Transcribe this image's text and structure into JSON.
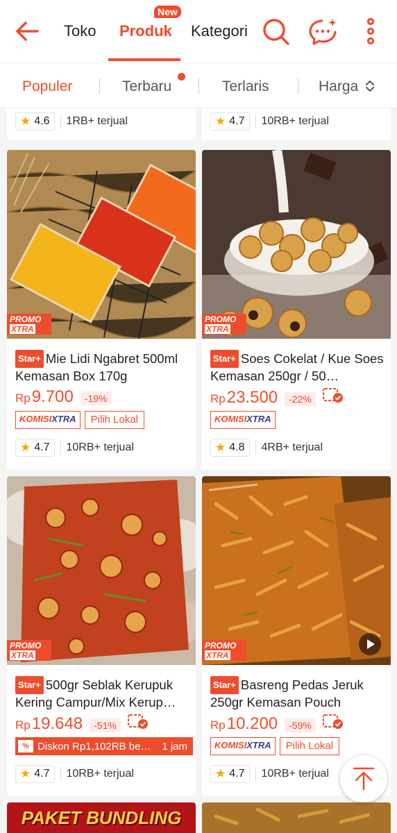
{
  "header": {
    "tabs": [
      {
        "label": "Toko"
      },
      {
        "label": "Produk"
      },
      {
        "label": "Kategori"
      }
    ],
    "new_badge": "New",
    "icons": [
      "back-arrow-icon",
      "search-icon",
      "chat-icon",
      "more-vertical-icon"
    ]
  },
  "sort": {
    "options": [
      {
        "label": "Populer"
      },
      {
        "label": "Terbaru"
      },
      {
        "label": "Terlaris"
      },
      {
        "label": "Harga"
      }
    ]
  },
  "top_partial": [
    {
      "rating": "4.6",
      "sold": "1RB+ terjual"
    },
    {
      "rating": "4.7",
      "sold": "10RB+ terjual"
    }
  ],
  "products": [
    {
      "badge": "Star+",
      "title": "Mie Lidi Ngabret 500ml Kemasan Box 170g",
      "currency": "Rp",
      "price": "9.700",
      "discount": "-19%",
      "promo_label": "PROMO",
      "promo_label2": "XTRA",
      "komisi_a": "KOMISI",
      "komisi_b": "XTRA",
      "lokal": "Pilih Lokal",
      "rating": "4.7",
      "sold": "10RB+ terjual"
    },
    {
      "badge": "Star+",
      "title": "Soes Cokelat / Kue Soes Kemasan 250gr / 50…",
      "currency": "Rp",
      "price": "23.500",
      "discount": "-22%",
      "promo_label": "PROMO",
      "promo_label2": "XTRA",
      "komisi_a": "KOMISI",
      "komisi_b": "XTRA",
      "rating": "4.8",
      "sold": "4RB+ terjual"
    },
    {
      "badge": "Star+",
      "title": "500gr Seblak Kerupuk Kering Campur/Mix Kerup…",
      "currency": "Rp",
      "price": "19.648",
      "discount": "-51%",
      "promo_label": "PROMO",
      "promo_label2": "XTRA",
      "diskon": "Diskon Rp1,102RB be…",
      "diskon_time": "1 jam",
      "rating": "4.7",
      "sold": "10RB+ terjual"
    },
    {
      "badge": "Star+",
      "title": "Basreng Pedas Jeruk 250gr Kemasan Pouch",
      "currency": "Rp",
      "price": "10.200",
      "discount": "-59%",
      "promo_label": "PROMO",
      "promo_label2": "XTRA",
      "komisi_a": "KOMISI",
      "komisi_b": "XTRA",
      "lokal": "Pilih Lokal",
      "rating": "4.7",
      "sold": "10RB+ terjual"
    }
  ],
  "bottom_banner": "PAKET BUNDLING",
  "colors": {
    "accent": "#ee4d2d",
    "background": "#f5f5f5"
  }
}
